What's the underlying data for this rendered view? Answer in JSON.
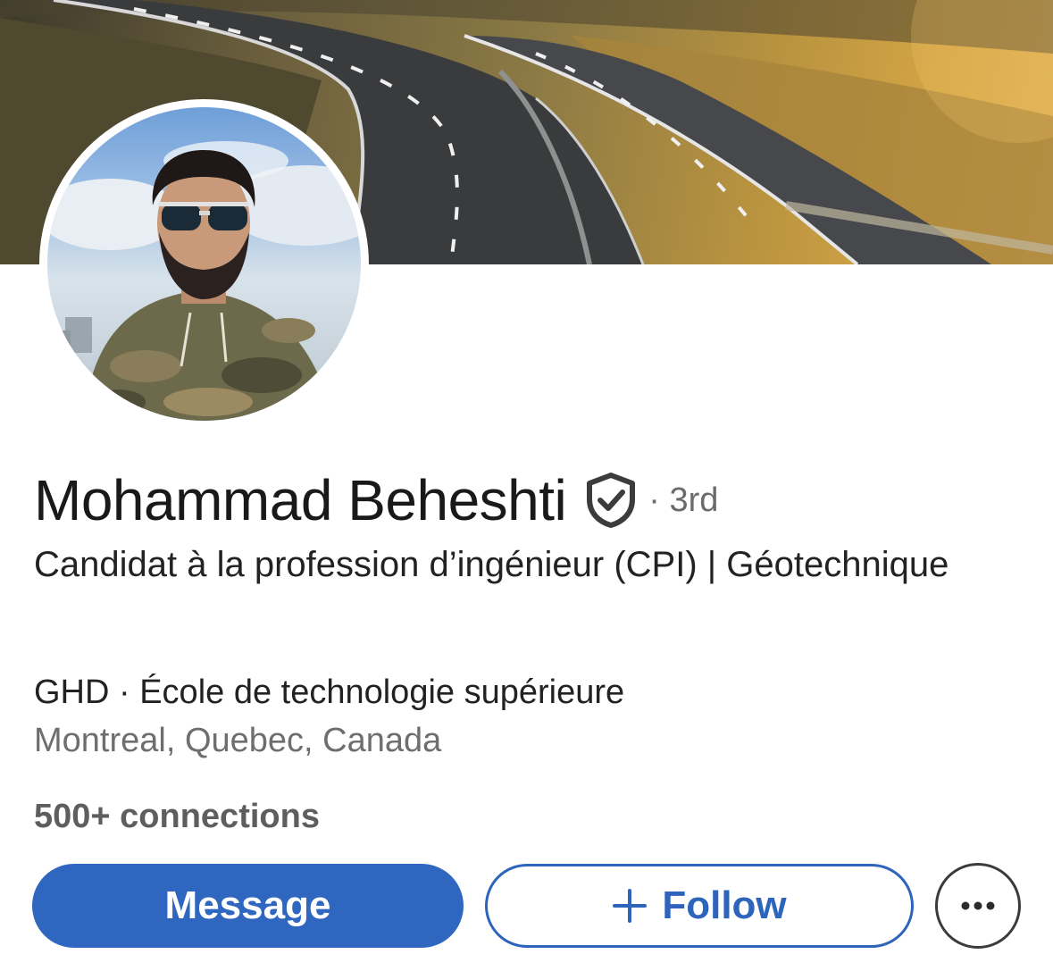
{
  "profile": {
    "name": "Mohammad Beheshti",
    "degree": "· 3rd",
    "headline": "Candidat à la profession d’ingénieur (CPI) | Géotechnique",
    "company_school": "GHD · École de technologie supérieure",
    "location": "Montreal, Quebec, Canada",
    "connections": "500+ connections"
  },
  "actions": {
    "message_label": "Message",
    "follow_label": "Follow",
    "more_icon": "ellipsis-icon",
    "follow_icon": "plus-icon"
  },
  "icons": {
    "verified": "verified-shield-icon"
  },
  "colors": {
    "primary_blue": "#2f67c0",
    "follow_blue": "#2d64bc",
    "name_text": "#191919",
    "secondary_text": "#6e6e6e"
  }
}
